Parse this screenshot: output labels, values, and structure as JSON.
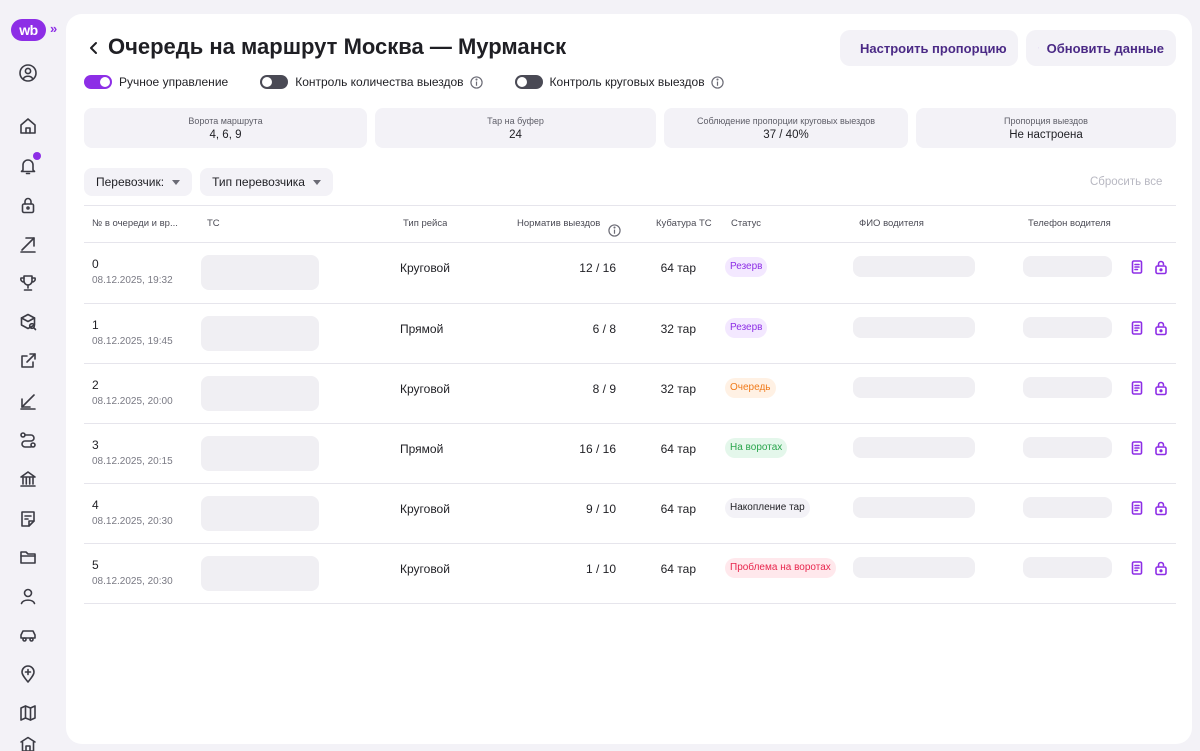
{
  "app": {
    "logo_text": "wb",
    "expand_glyph": "»"
  },
  "sidebar": {
    "items": [
      {
        "icon": "user-circle-icon"
      },
      {
        "icon": "home-icon"
      },
      {
        "icon": "bell-icon",
        "has_notification": true
      },
      {
        "icon": "lock-icon"
      },
      {
        "icon": "arrow-up-right-icon"
      },
      {
        "icon": "trophy-icon"
      },
      {
        "icon": "box-search-icon"
      },
      {
        "icon": "external-link-icon"
      },
      {
        "icon": "arrow-down-left-icon"
      },
      {
        "icon": "route-icon"
      },
      {
        "icon": "bank-icon"
      },
      {
        "icon": "note-icon"
      },
      {
        "icon": "folder-icon"
      },
      {
        "icon": "person-icon"
      },
      {
        "icon": "car-icon"
      },
      {
        "icon": "map-pin-plus-icon"
      },
      {
        "icon": "map-icon"
      },
      {
        "icon": "building-icon"
      }
    ]
  },
  "header": {
    "title": "Очередь на маршрут Москва — Мурманск",
    "buttons": {
      "proportion": "Настроить пропорцию",
      "refresh": "Обновить данные"
    }
  },
  "toggles": [
    {
      "label": "Ручное управление",
      "on": true,
      "info": false
    },
    {
      "label": "Контроль количества выездов",
      "on": false,
      "info": true
    },
    {
      "label": "Контроль круговых выездов",
      "on": false,
      "info": true
    }
  ],
  "stats": [
    {
      "label": "Ворота маршрута",
      "value": "4, 6, 9"
    },
    {
      "label": "Тар на буфер",
      "value": "24"
    },
    {
      "label": "Соблюдение пропорции круговых выездов",
      "value": "37 / 40%"
    },
    {
      "label": "Пропорция выездов",
      "value": "Не настроена"
    }
  ],
  "filters": {
    "carrier": "Перевозчик:",
    "carrier_type": "Тип перевозчика",
    "reset": "Сбросить все"
  },
  "table": {
    "columns": {
      "queue": "№ в очереди и вр...",
      "ts": "ТС",
      "trip_type": "Тип рейса",
      "norm": "Норматив выездов",
      "cubature": "Кубатура ТС",
      "status": "Статус",
      "fio": "ФИО водителя",
      "phone": "Телефон водителя"
    },
    "rows": [
      {
        "num": "0",
        "datetime": "08.12.2025, 19:32",
        "trip_type": "Круговой",
        "norm": "12 / 16",
        "cubature": "64 тар",
        "status": "Резерв",
        "status_kind": "reserve"
      },
      {
        "num": "1",
        "datetime": "08.12.2025, 19:45",
        "trip_type": "Прямой",
        "norm": "6 / 8",
        "cubature": "32 тар",
        "status": "Резерв",
        "status_kind": "reserve"
      },
      {
        "num": "2",
        "datetime": "08.12.2025, 20:00",
        "trip_type": "Круговой",
        "norm": "8 / 9",
        "cubature": "32 тар",
        "status": "Очередь",
        "status_kind": "queue"
      },
      {
        "num": "3",
        "datetime": "08.12.2025, 20:15",
        "trip_type": "Прямой",
        "norm": "16 / 16",
        "cubature": "64 тар",
        "status": "На воротах",
        "status_kind": "gate"
      },
      {
        "num": "4",
        "datetime": "08.12.2025, 20:30",
        "trip_type": "Круговой",
        "norm": "9 / 10",
        "cubature": "64 тар",
        "status": "Накопление тар",
        "status_kind": "accum"
      },
      {
        "num": "5",
        "datetime": "08.12.2025, 20:30",
        "trip_type": "Круговой",
        "norm": "1 / 10",
        "cubature": "64 тар",
        "status": "Проблема на воротах",
        "status_kind": "problem"
      }
    ]
  },
  "colors": {
    "accent": "#8d2ee6",
    "reserve": "#8d2ee6",
    "queue": "#f07a1a",
    "gate": "#2aa54d",
    "problem": "#e8264d"
  }
}
